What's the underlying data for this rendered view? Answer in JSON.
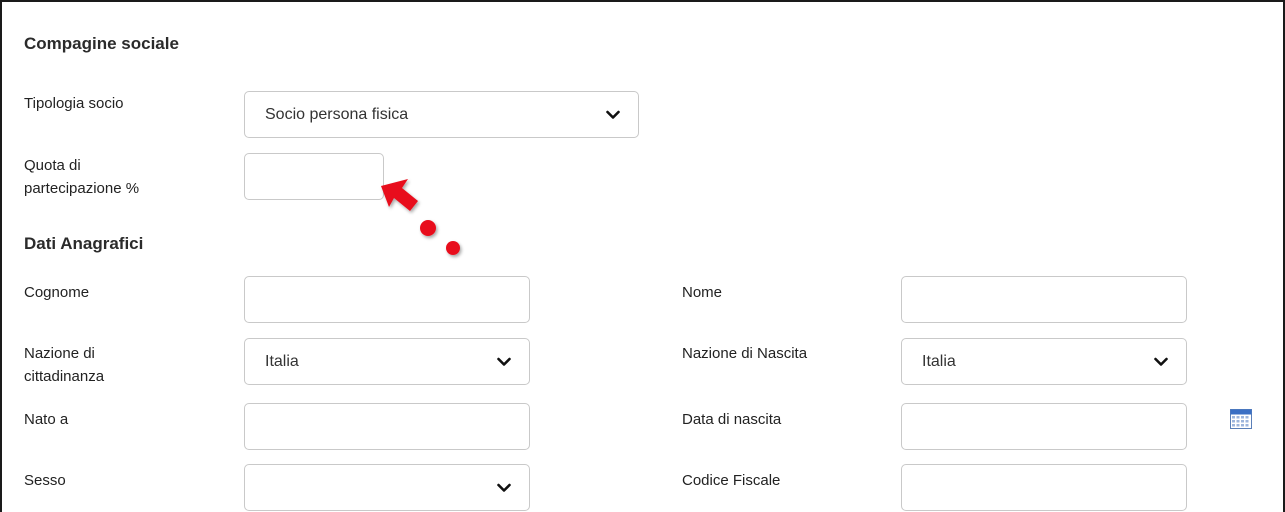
{
  "sections": {
    "compagine": "Compagine sociale",
    "anagrafici": "Dati Anagrafici"
  },
  "fields": {
    "tipologia_socio": {
      "label": "Tipologia socio",
      "value": "Socio persona fisica"
    },
    "quota": {
      "label_line1": "Quota di",
      "label_line2": "partecipazione %",
      "value": ""
    },
    "cognome": {
      "label": "Cognome",
      "value": ""
    },
    "nome": {
      "label": "Nome",
      "value": ""
    },
    "nazione_cittadinanza": {
      "label_line1": "Nazione di",
      "label_line2": "cittadinanza",
      "value": "Italia"
    },
    "nazione_nascita": {
      "label": "Nazione di Nascita",
      "value": "Italia"
    },
    "nato_a": {
      "label": "Nato a",
      "value": ""
    },
    "data_nascita": {
      "label": "Data di nascita",
      "value": ""
    },
    "sesso": {
      "label": "Sesso",
      "value": ""
    },
    "codice_fiscale": {
      "label": "Codice Fiscale",
      "value": ""
    }
  },
  "icons": {
    "chevron": "chevron-down-icon",
    "calendar": "calendar-icon",
    "pointer": "red-arrow-pointer-icon"
  },
  "colors": {
    "pointer": "#e8101c",
    "border": "#c9c9c9",
    "calendar": "#3a6fc4"
  }
}
